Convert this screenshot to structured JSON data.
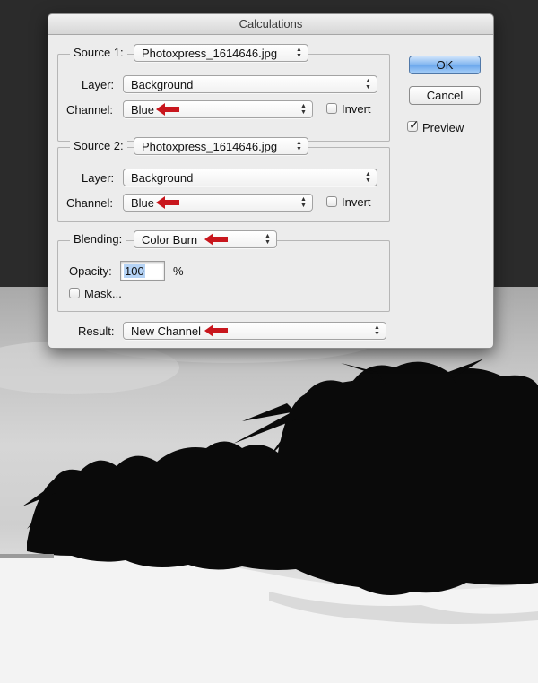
{
  "dialog": {
    "title": "Calculations",
    "source1": {
      "label": "Source 1:",
      "file": "Photoxpress_1614646.jpg",
      "layer_label": "Layer:",
      "layer": "Background",
      "channel_label": "Channel:",
      "channel": "Blue",
      "invert_label": "Invert",
      "invert_checked": false
    },
    "source2": {
      "label": "Source 2:",
      "file": "Photoxpress_1614646.jpg",
      "layer_label": "Layer:",
      "layer": "Background",
      "channel_label": "Channel:",
      "channel": "Blue",
      "invert_label": "Invert",
      "invert_checked": false
    },
    "blending": {
      "label": "Blending:",
      "mode": "Color Burn",
      "opacity_label": "Opacity:",
      "opacity": "100",
      "percent": "%",
      "mask_label": "Mask...",
      "mask_checked": false
    },
    "result": {
      "label": "Result:",
      "value": "New Channel"
    },
    "buttons": {
      "ok": "OK",
      "cancel": "Cancel"
    },
    "preview": {
      "label": "Preview",
      "checked": true
    }
  },
  "colors": {
    "annotation_arrow": "#c8161d",
    "default_button": "#6aa6ec"
  }
}
